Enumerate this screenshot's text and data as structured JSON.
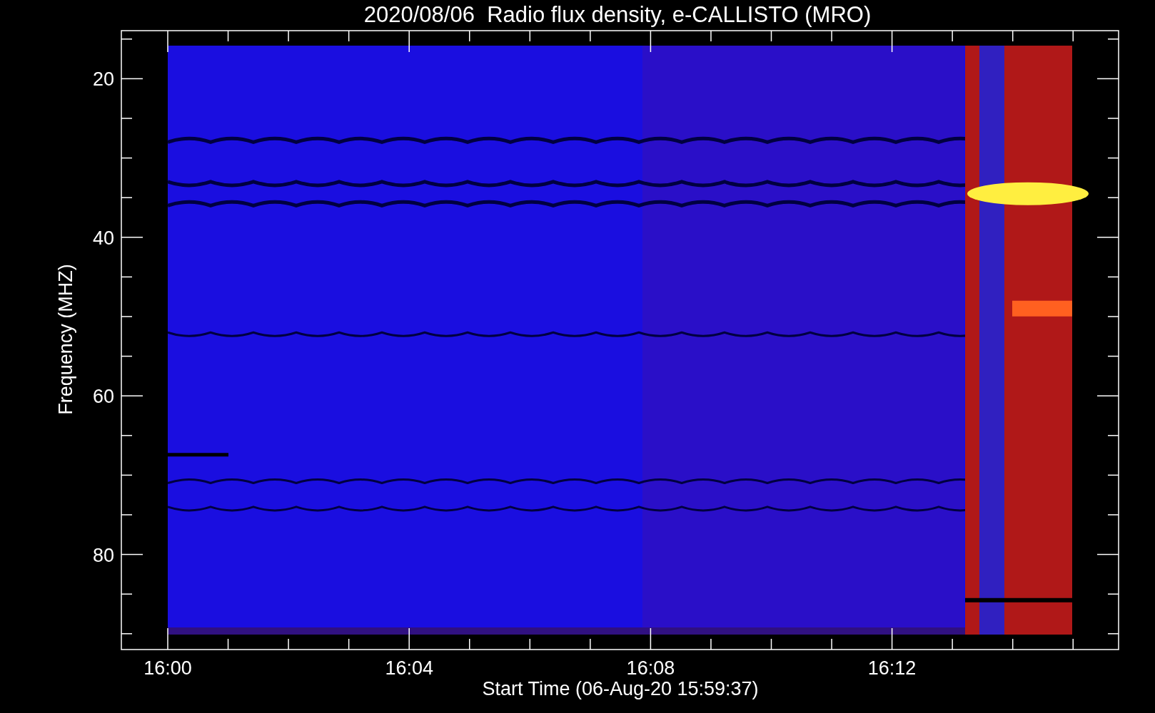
{
  "title": "2020/08/06  Radio flux density, e-CALLISTO (MRO)",
  "y_axis": {
    "label": "Frequency (MHZ)",
    "ticks": [
      "20",
      "40",
      "60",
      "80"
    ]
  },
  "x_axis": {
    "label": "Start Time (06-Aug-20 15:59:37)",
    "ticks": [
      "16:00",
      "16:04",
      "16:08",
      "16:12"
    ]
  }
}
